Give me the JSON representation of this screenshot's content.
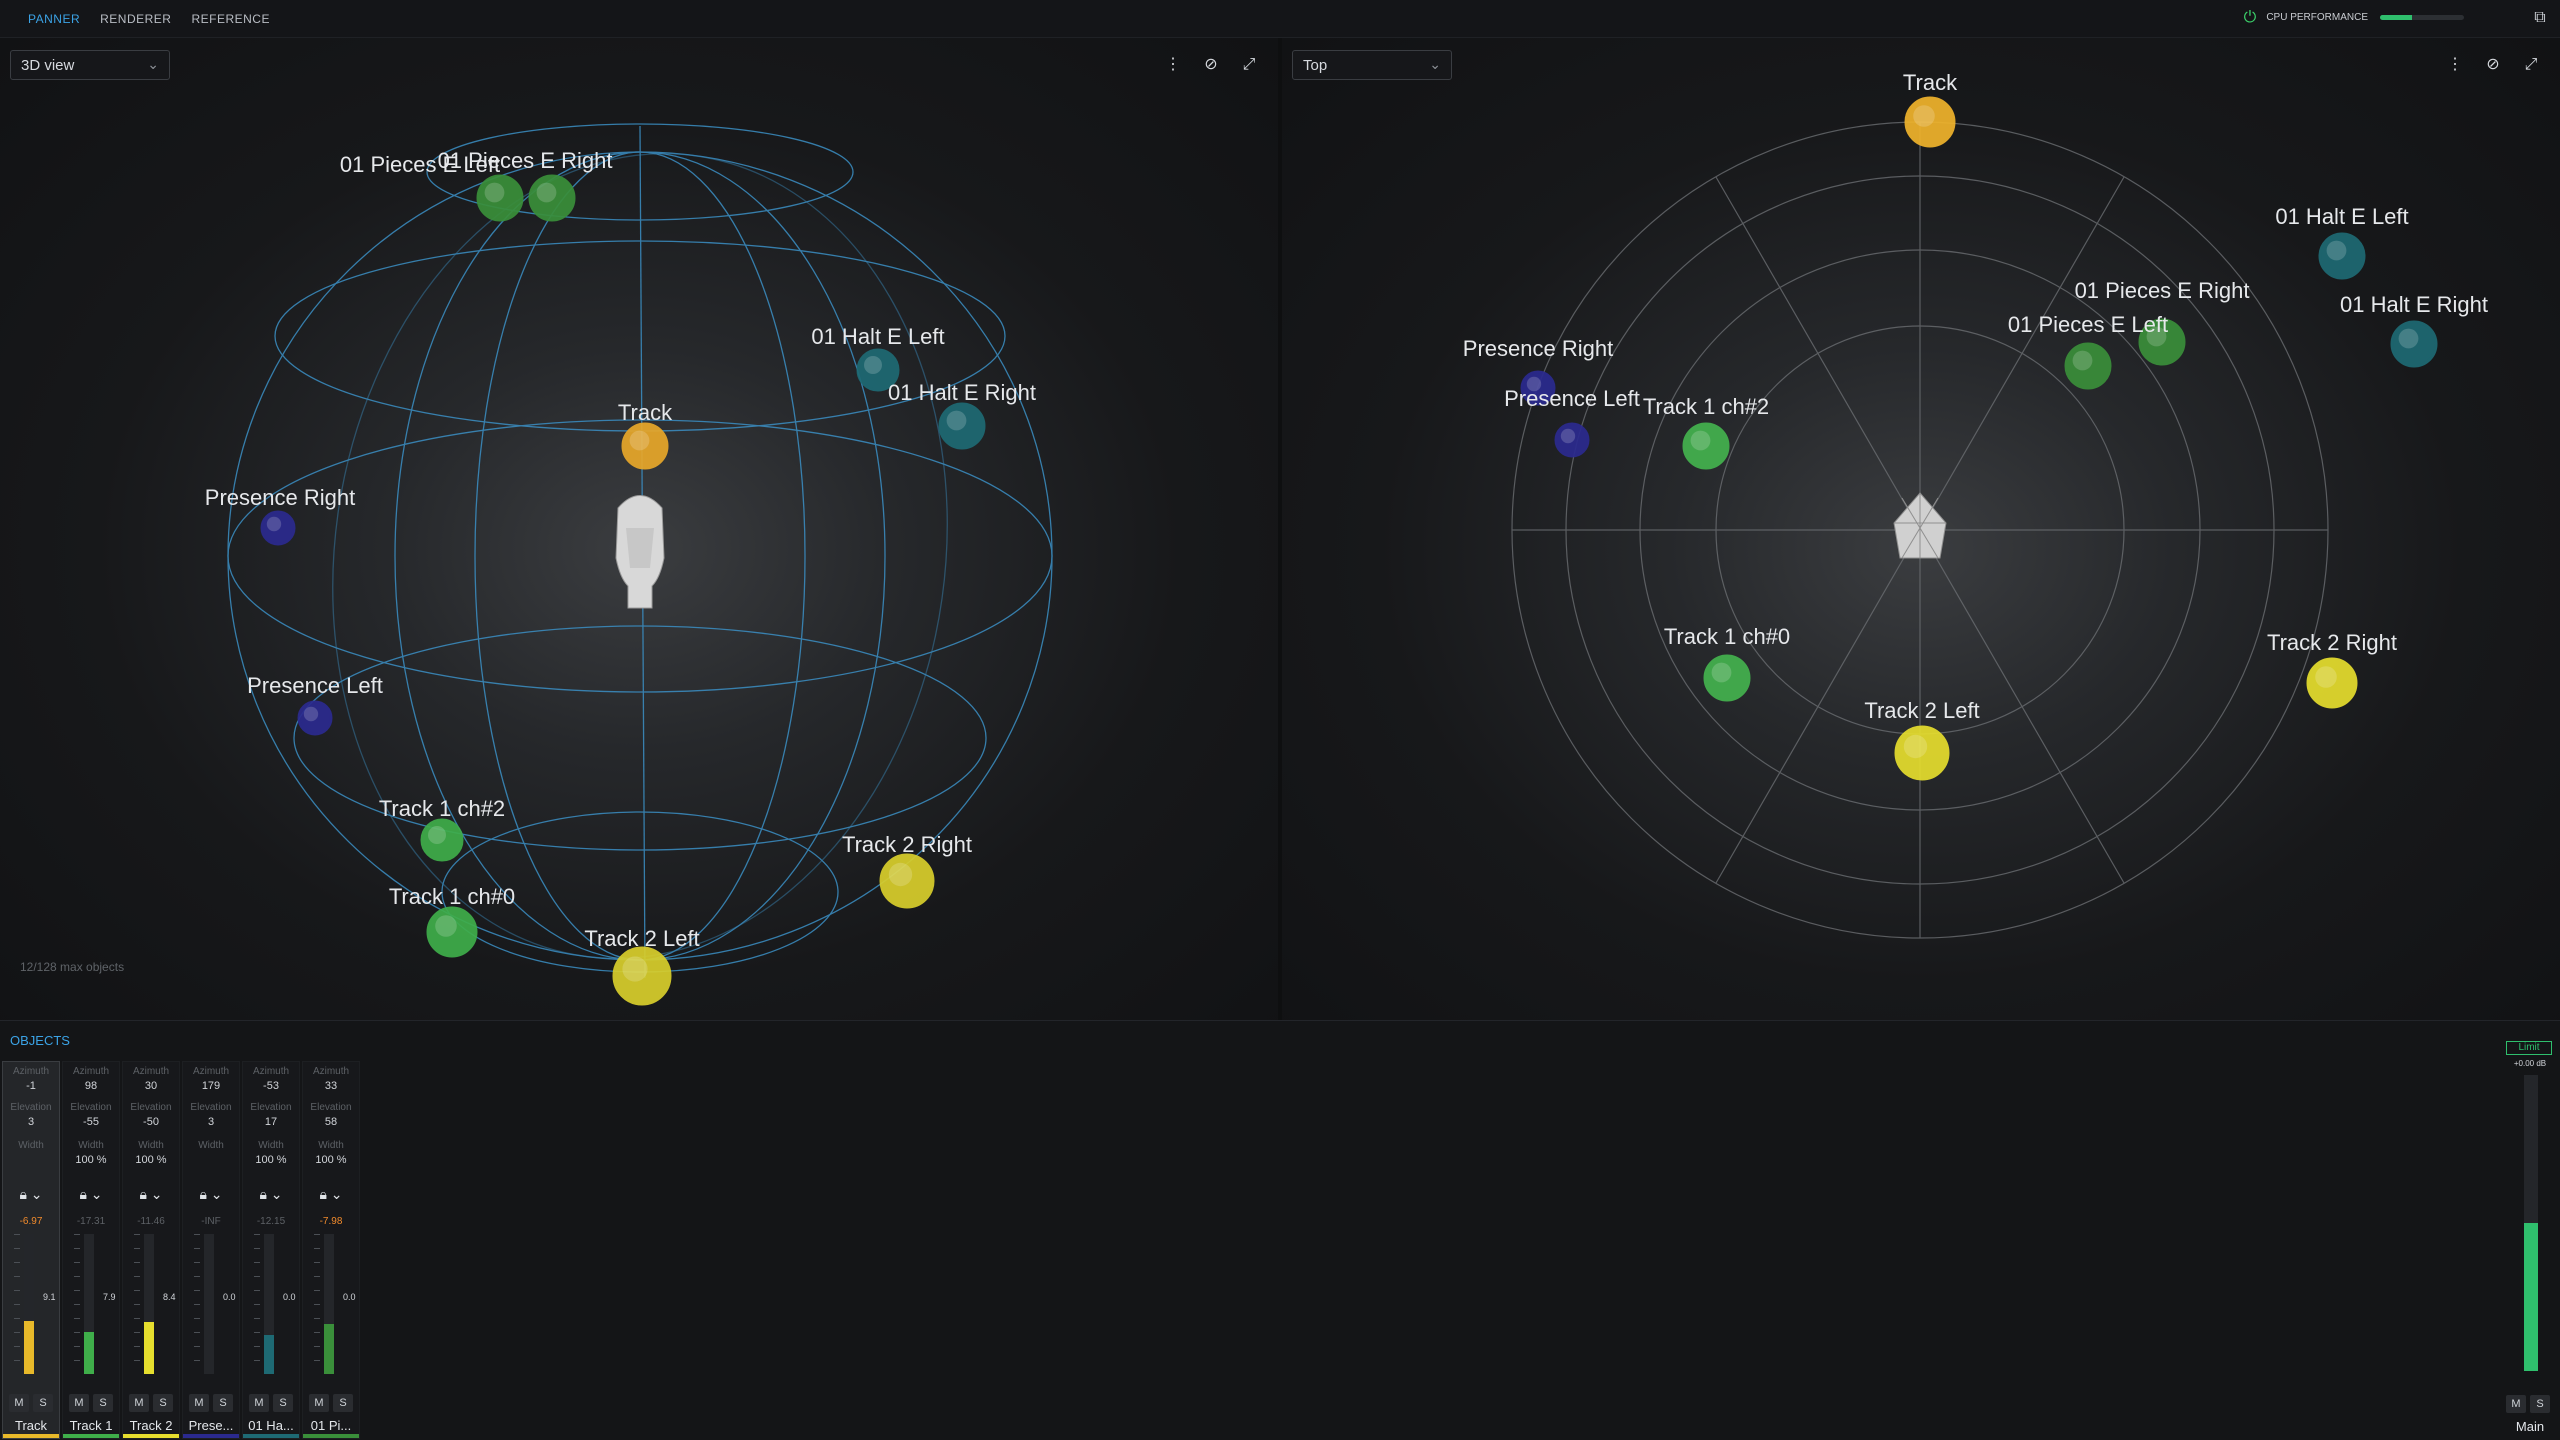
{
  "topbar": {
    "tabs": [
      "PANNER",
      "RENDERER",
      "REFERENCE"
    ],
    "active_tab": "PANNER",
    "cpu_label": "CPU PERFORMANCE",
    "cpu_level": 0.38
  },
  "left_view": {
    "mode": "3D view",
    "objects": [
      {
        "label": "01 Pieces E Left",
        "color": "#3a8f3a"
      },
      {
        "label": "01 Pieces E Right",
        "color": "#3a8f3a"
      },
      {
        "label": "01 Halt E Left",
        "color": "#1e6a74"
      },
      {
        "label": "01 Halt E Right",
        "color": "#1e6a74"
      },
      {
        "label": "Track",
        "color": "#e8a82a"
      },
      {
        "label": "Presence Right",
        "color": "#2b2a8f"
      },
      {
        "label": "Presence Left",
        "color": "#2b2a8f"
      },
      {
        "label": "Track 1 ch#2",
        "color": "#3fae4a"
      },
      {
        "label": "Track 1 ch#0",
        "color": "#3fae4a"
      },
      {
        "label": "Track 2 Right",
        "color": "#d9cf2c"
      },
      {
        "label": "Track 2 Left",
        "color": "#d9cf2c"
      }
    ],
    "max_objects": "12/128 max objects"
  },
  "right_view": {
    "mode": "Top",
    "objects": [
      {
        "label": "Track",
        "color": "#f0b42c"
      },
      {
        "label": "01 Halt E Left",
        "color": "#1e6a74"
      },
      {
        "label": "01 Halt E Right",
        "color": "#1e6a74"
      },
      {
        "label": "01 Pieces E Right",
        "color": "#3a8f3a"
      },
      {
        "label": "01 Pieces E Left",
        "color": "#3a8f3a"
      },
      {
        "label": "Presence Right",
        "color": "#2b2a8f"
      },
      {
        "label": "Presence Left",
        "color": "#2b2a8f"
      },
      {
        "label": "Track 1 ch#2",
        "color": "#44b24e"
      },
      {
        "label": "Track 1 ch#0",
        "color": "#44b24e"
      },
      {
        "label": "Track 2 Right",
        "color": "#e6de2e"
      },
      {
        "label": "Track 2 Left",
        "color": "#e6de2e"
      }
    ]
  },
  "objects_panel": {
    "title": "OBJECTS",
    "labels": {
      "azimuth": "Azimuth",
      "elevation": "Elevation",
      "width": "Width"
    },
    "mute": "M",
    "solo": "S",
    "strips": [
      {
        "name": "Track",
        "azimuth": "-1",
        "elevation": "3",
        "width": "",
        "db": "-6.97",
        "db_hot": true,
        "level": 0.38,
        "fader": "9.1",
        "color": "#e8b92a",
        "selected": true
      },
      {
        "name": "Track 1",
        "azimuth": "98",
        "elevation": "-55",
        "width": "100 %",
        "db": "-17.31",
        "db_hot": false,
        "level": 0.3,
        "fader": "7.9",
        "color": "#3fae4a",
        "selected": false
      },
      {
        "name": "Track 2",
        "azimuth": "30",
        "elevation": "-50",
        "width": "100 %",
        "db": "-11.46",
        "db_hot": false,
        "level": 0.37,
        "fader": "8.4",
        "color": "#e6de2e",
        "selected": false
      },
      {
        "name": "Prese...",
        "azimuth": "179",
        "elevation": "3",
        "width": "",
        "db": "-INF",
        "db_hot": false,
        "level": 0.0,
        "fader": "0.0",
        "color": "#2b2a8f",
        "selected": false
      },
      {
        "name": "01 Ha...",
        "azimuth": "-53",
        "elevation": "17",
        "width": "100 %",
        "db": "-12.15",
        "db_hot": false,
        "level": 0.28,
        "fader": "0.0",
        "color": "#1e6a74",
        "selected": false
      },
      {
        "name": "01 Pi...",
        "azimuth": "33",
        "elevation": "58",
        "width": "100 %",
        "db": "-7.98",
        "db_hot": true,
        "level": 0.36,
        "fader": "0.0",
        "color": "#3a8f3a",
        "selected": false
      }
    ],
    "master": {
      "limit": "Limit",
      "db": "+0.00 dB",
      "level": 0.5,
      "name": "Main"
    }
  }
}
